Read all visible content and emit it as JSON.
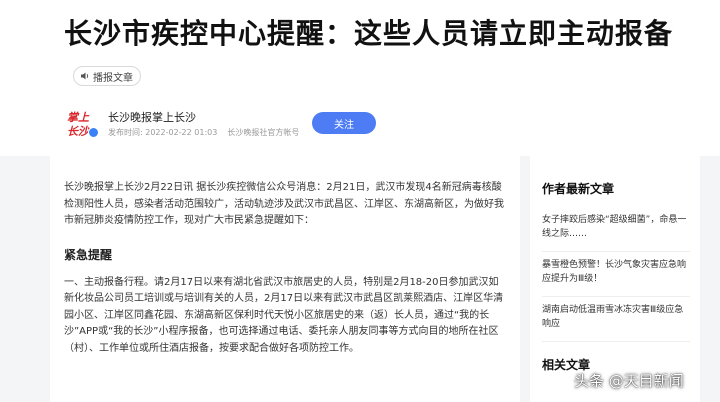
{
  "article": {
    "title": "长沙市疾控中心提醒：这些人员请立即主动报备",
    "audio_label": "播报文章",
    "author": {
      "name": "长沙晚报掌上长沙",
      "logo_text": "掌上长沙",
      "date": "发布时间: 2022-02-22 01:03",
      "official": "长沙晚报社官方帐号",
      "follow_label": "关注"
    },
    "intro": "长沙晚报掌上长沙2月22日讯 据长沙疾控微信公众号消息：2月21日，武汉市发现4名新冠病毒核酸检测阳性人员，感染者活动范围较广，活动轨迹涉及武汉市武昌区、江岸区、东湖高新区，为做好我市新冠肺炎疫情防控工作，现对广大市民紧急提醒如下：",
    "heading": "紧急提醒",
    "body": "一、主动报备行程。请2月17日以来有湖北省武汉市旅居史的人员，特别是2月18-20日参加武汉如新化妆品公司员工培训或与培训有关的人员，2月17日以来有武汉市武昌区凯莱熙酒店、江岸区华清园小区、江岸区同鑫花园、东湖高新区保利时代天悦小区旅居史的来（返）长人员，通过“我的长沙”APP或“我的长沙”小程序报备，也可选择通过电话、委托亲人朋友同事等方式向目的地所在社区（村）、工作单位或所住酒店报备，按要求配合做好各项防控工作。"
  },
  "sidebar": {
    "title": "作者最新文章",
    "items": [
      "女子摔跤后感染“超级细菌”，命悬一线之际……",
      "暴雪橙色预警！长沙气象灾害应急响应提升为Ⅲ级！",
      "湖南启动低温雨雪冰冻灾害Ⅲ级应急响应"
    ],
    "title2": "相关文章"
  },
  "watermark": "头条 @天目新闻",
  "colors": {
    "accent": "#4e7cf5",
    "logo_red": "#d8262b",
    "verify": "#3b82f6"
  }
}
